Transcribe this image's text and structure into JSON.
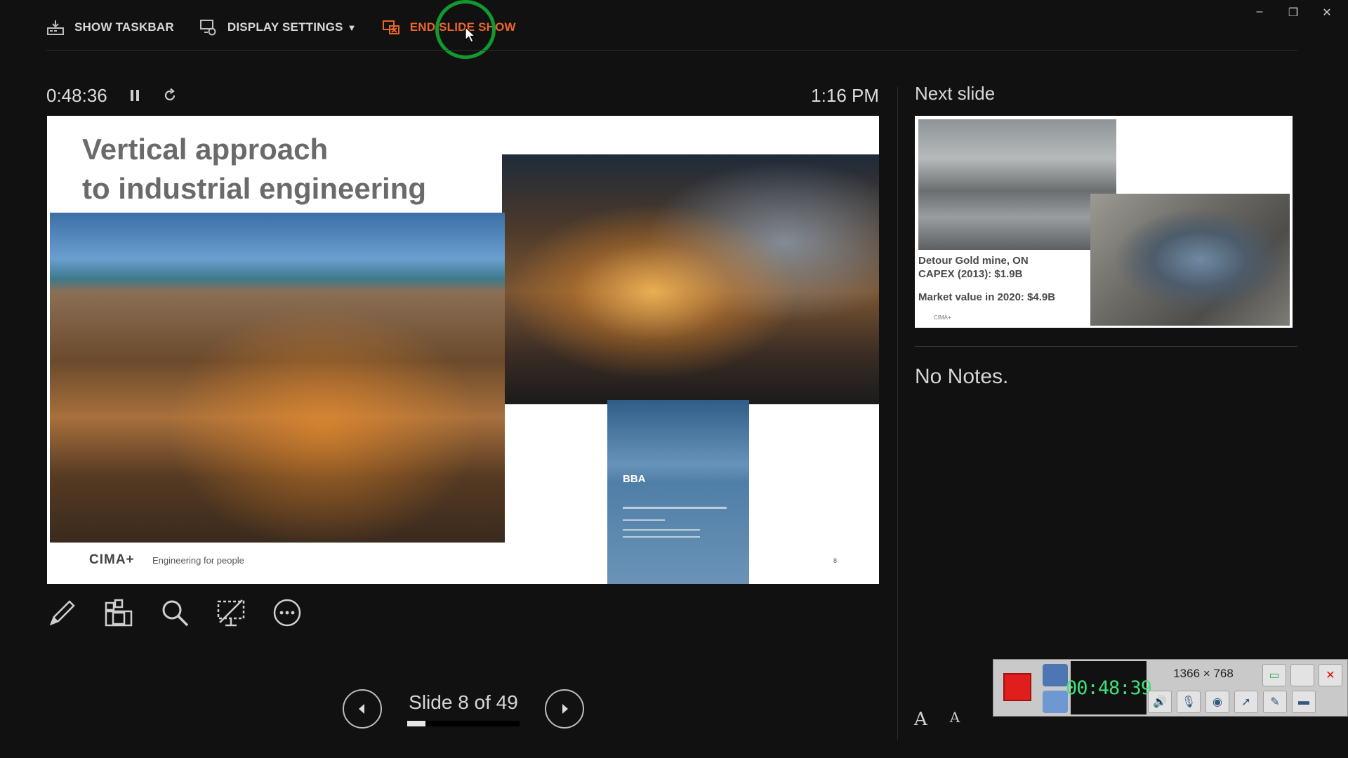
{
  "toolbar": {
    "show_taskbar": "SHOW TASKBAR",
    "display_settings": "DISPLAY SETTINGS",
    "end_slide_show": "END SLIDE SHOW"
  },
  "window_controls": {
    "minimize": "–",
    "restore": "❐",
    "close": "✕"
  },
  "timer": {
    "elapsed": "0:48:36",
    "clock": "1:16 PM"
  },
  "current_slide": {
    "title_line1": "Vertical approach",
    "title_line2": "to industrial engineering",
    "logo": "CIMA+",
    "tagline": "Engineering for people",
    "doc_logo": "BBA",
    "page_number": "8"
  },
  "navigation": {
    "counter": "Slide 8 of 49",
    "current": 8,
    "total": 49
  },
  "next_slide": {
    "label": "Next slide",
    "line1": "Detour Gold mine, ON",
    "line2": "CAPEX (2013): $1.9B",
    "market": "Market value in 2020: $4.9B",
    "logo": "CIMA+"
  },
  "notes": {
    "text": "No Notes."
  },
  "font_buttons": {
    "increase": "A",
    "decrease": "A"
  },
  "recorder": {
    "time": "00:48:39",
    "resolution": "1366 × 768"
  },
  "colors": {
    "background": "#111111",
    "end_show_accent": "#e8652d",
    "highlight_ring": "#129a2e",
    "record_red": "#e01e1e",
    "timer_green": "#3fe07a"
  }
}
